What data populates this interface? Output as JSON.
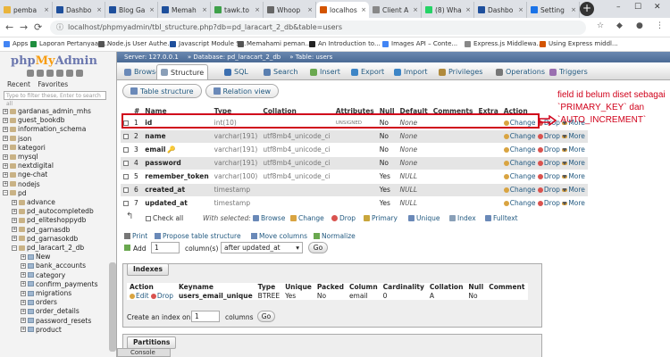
{
  "browser": {
    "tabs": [
      {
        "label": "pemba",
        "color": "#e9b43c"
      },
      {
        "label": "Dashbo",
        "color": "#1e4f9c"
      },
      {
        "label": "Blog Ga",
        "color": "#1e4f9c"
      },
      {
        "label": "Memah",
        "color": "#1e4f9c"
      },
      {
        "label": "tawk.to",
        "color": "#3fa14a"
      },
      {
        "label": "Whoop",
        "color": "#666666"
      },
      {
        "label": "localhos",
        "color": "#d35400"
      },
      {
        "label": "Client A",
        "color": "#888888"
      },
      {
        "label": "(8) Wha",
        "color": "#25d366"
      },
      {
        "label": "Dashbo",
        "color": "#1e4f9c"
      },
      {
        "label": "Setting",
        "color": "#1a73e8"
      }
    ],
    "new_tab": "+",
    "url": "localhost/phpmyadmin/tbl_structure.php?db=pd_laracart_2_db&table=users",
    "bookmarks": [
      {
        "label": "Apps",
        "color": "#4285f4"
      },
      {
        "label": "Laporan Pertanyaan...",
        "color": "#1e8e3e"
      },
      {
        "label": "Node.js User Authe...",
        "color": "#555555"
      },
      {
        "label": "Javascript Module S...",
        "color": "#1e4f9c"
      },
      {
        "label": "Memahami peman...",
        "color": "#555555"
      },
      {
        "label": "An Introduction to...",
        "color": "#222222"
      },
      {
        "label": "Images API – Conte...",
        "color": "#4285f4"
      },
      {
        "label": "Express.js Middlewa...",
        "color": "#888888"
      },
      {
        "label": "Using Express middl...",
        "color": "#d35400"
      }
    ]
  },
  "sidebar": {
    "logo_php": "php",
    "logo_my": "My",
    "logo_admin": "Admin",
    "recent": "Recent",
    "favorites": "Favorites",
    "filter_placeholder": "Type to filter these, Enter to search all",
    "databases": [
      "gardanas_admin_mhs",
      "guest_bookdb",
      "information_schema",
      "json",
      "kategori",
      "mysql",
      "nextdigital",
      "nge-chat",
      "nodejs",
      "pd"
    ],
    "pd_children": [
      "advance",
      "pd_autocompletedb",
      "pd_eliteshoppydb",
      "pd_garnasdb",
      "pd_garnasokdb",
      "pd_laracart_2_db"
    ],
    "tables": [
      "New",
      "bank_accounts",
      "category",
      "confirm_payments",
      "migrations",
      "orders",
      "order_details",
      "password_resets",
      "product"
    ]
  },
  "breadcrumb": {
    "server": "Server: 127.0.0.1",
    "database": "Database: pd_laracart_2_db",
    "table": "Table: users"
  },
  "menu_tabs": [
    {
      "label": "Browse",
      "color": "#6a89b8"
    },
    {
      "label": "Structure",
      "color": "#8a9fb8"
    },
    {
      "label": "SQL",
      "color": "#3c6fb0"
    },
    {
      "label": "Search",
      "color": "#5a7fb0"
    },
    {
      "label": "Insert",
      "color": "#6aa84f"
    },
    {
      "label": "Export",
      "color": "#3d85c6"
    },
    {
      "label": "Import",
      "color": "#3d85c6"
    },
    {
      "label": "Privileges",
      "color": "#b08a3c"
    },
    {
      "label": "Operations",
      "color": "#777777"
    },
    {
      "label": "Triggers",
      "color": "#9a6fb0"
    }
  ],
  "sub_tabs": {
    "table_structure": "Table structure",
    "relation_view": "Relation view"
  },
  "structure": {
    "headers": [
      "#",
      "Name",
      "Type",
      "Collation",
      "Attributes",
      "Null",
      "Default",
      "Comments",
      "Extra",
      "Action"
    ],
    "rows": [
      {
        "num": "1",
        "name": "id",
        "type": "int(10)",
        "collation": "",
        "attributes": "UNSIGNED",
        "null": "No",
        "default": "None"
      },
      {
        "num": "2",
        "name": "name",
        "type": "varchar(191)",
        "collation": "utf8mb4_unicode_ci",
        "attributes": "",
        "null": "No",
        "default": "None"
      },
      {
        "num": "3",
        "name": "email",
        "type": "varchar(191)",
        "collation": "utf8mb4_unicode_ci",
        "attributes": "",
        "null": "No",
        "default": "None"
      },
      {
        "num": "4",
        "name": "password",
        "type": "varchar(191)",
        "collation": "utf8mb4_unicode_ci",
        "attributes": "",
        "null": "No",
        "default": "None"
      },
      {
        "num": "5",
        "name": "remember_token",
        "type": "varchar(100)",
        "collation": "utf8mb4_unicode_ci",
        "attributes": "",
        "null": "Yes",
        "default": "NULL"
      },
      {
        "num": "6",
        "name": "created_at",
        "type": "timestamp",
        "collation": "",
        "attributes": "",
        "null": "Yes",
        "default": "NULL"
      },
      {
        "num": "7",
        "name": "updated_at",
        "type": "timestamp",
        "collation": "",
        "attributes": "",
        "null": "Yes",
        "default": "NULL"
      }
    ],
    "action_change": "Change",
    "action_drop": "Drop",
    "action_more": "More"
  },
  "annotation": {
    "text": "field id belum diset sebagai `PRIMARY_KEY` dan `AUTO_INCREMENT`",
    "color": "#d0021b"
  },
  "bulk": {
    "check_all": "Check all",
    "with_selected": "With selected:",
    "browse": "Browse",
    "change": "Change",
    "drop": "Drop",
    "primary": "Primary",
    "unique": "Unique",
    "index": "Index",
    "fulltext": "Fulltext"
  },
  "tools": {
    "print": "Print",
    "propose": "Propose table structure",
    "move": "Move columns",
    "normalize": "Normalize"
  },
  "add_columns": {
    "add": "Add",
    "count": "1",
    "columns_label": "column(s)",
    "position": "after updated_at",
    "go": "Go"
  },
  "indexes": {
    "legend": "Indexes",
    "headers": [
      "Action",
      "Keyname",
      "Type",
      "Unique",
      "Packed",
      "Column",
      "Cardinality",
      "Collation",
      "Null",
      "Comment"
    ],
    "row": {
      "edit": "Edit",
      "drop": "Drop",
      "keyname": "users_email_unique",
      "type": "BTREE",
      "unique": "Yes",
      "packed": "No",
      "column": "email",
      "cardinality": "0",
      "collation": "A",
      "null": "No",
      "comment": ""
    },
    "create_label": "Create an index on",
    "create_count": "1",
    "columns_label": "columns",
    "go": "Go"
  },
  "partitions": {
    "legend": "Partitions"
  },
  "console": "Console"
}
